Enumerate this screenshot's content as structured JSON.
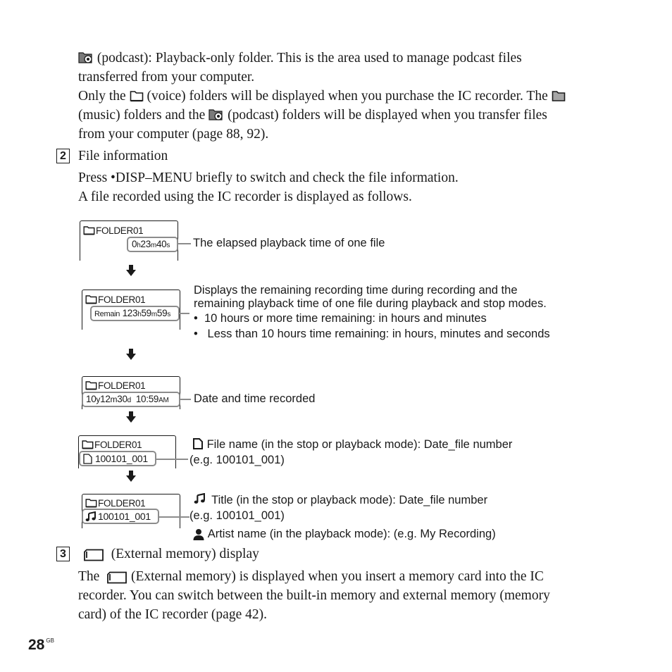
{
  "intro": {
    "line1_suffix": "(podcast): Playback-only folder. This is the area used to manage podcast files",
    "line2": "transferred from your computer.",
    "line3_prefix": "Only the",
    "line3_mid": "(voice) folders will be displayed when you purchase the IC recorder. The",
    "line4_prefix": "(music) folders and the",
    "line4_suffix": "(podcast) folders will be displayed when you transfer files",
    "line5": "from your computer (page 88, 92)."
  },
  "section2": {
    "number": "2",
    "heading": "File information",
    "line1": "Press •DISP–MENU briefly to switch and check the file information.",
    "line2": "A file recorded using the IC recorder is displayed as follows."
  },
  "diagram": {
    "screens": [
      {
        "folder": "FOLDER01",
        "value_parts": [
          "0",
          "h",
          "23",
          "m",
          "40",
          "s"
        ],
        "callout": [
          "The elapsed playback time of one file"
        ]
      },
      {
        "folder": "FOLDER01",
        "value_prefix": "Remain",
        "value_parts": [
          "123",
          "h",
          "59",
          "m",
          "59",
          "s"
        ],
        "callout": [
          "Displays the remaining recording time during recording and the",
          "remaining playback time of one file during playback and stop modes."
        ],
        "bullets": [
          "10 hours or more time remaining: in hours and minutes",
          "Less than 10 hours time remaining: in hours, minutes and seconds"
        ]
      },
      {
        "folder": "FOLDER01",
        "value_parts": [
          "10",
          "y",
          "12",
          "m",
          "30",
          "d",
          "  10:59",
          "AM"
        ],
        "callout": [
          "Date and time recorded"
        ]
      },
      {
        "folder": "FOLDER01",
        "value": "100101_001",
        "value_icon": "file-icon",
        "callout": [
          "File name (in the stop or playback mode): Date_file number",
          "(e.g. 100101_001)"
        ]
      },
      {
        "folder": "FOLDER01",
        "value": "100101_001",
        "value_icon": "music-note-icon",
        "callout": [
          "Title (in the stop or playback mode): Date_file number",
          "(e.g. 100101_001)",
          "Artist name (in the playback mode): (e.g. My Recording)"
        ]
      }
    ]
  },
  "section3": {
    "number": "3",
    "heading": "(External memory) display",
    "line1_prefix": "The",
    "line1_suffix": "(External memory) is displayed when you insert a memory card into the IC",
    "line2": "recorder. You can switch between the built-in memory and external memory (memory",
    "line3": "card) of the IC recorder (page 42)."
  },
  "footer": {
    "page_number": "28",
    "page_suffix": "GB"
  },
  "colors": {
    "text": "#1a1a1a",
    "highlight_border": "#8c8c8c",
    "music_folder_fill": "#a6a6a6"
  }
}
